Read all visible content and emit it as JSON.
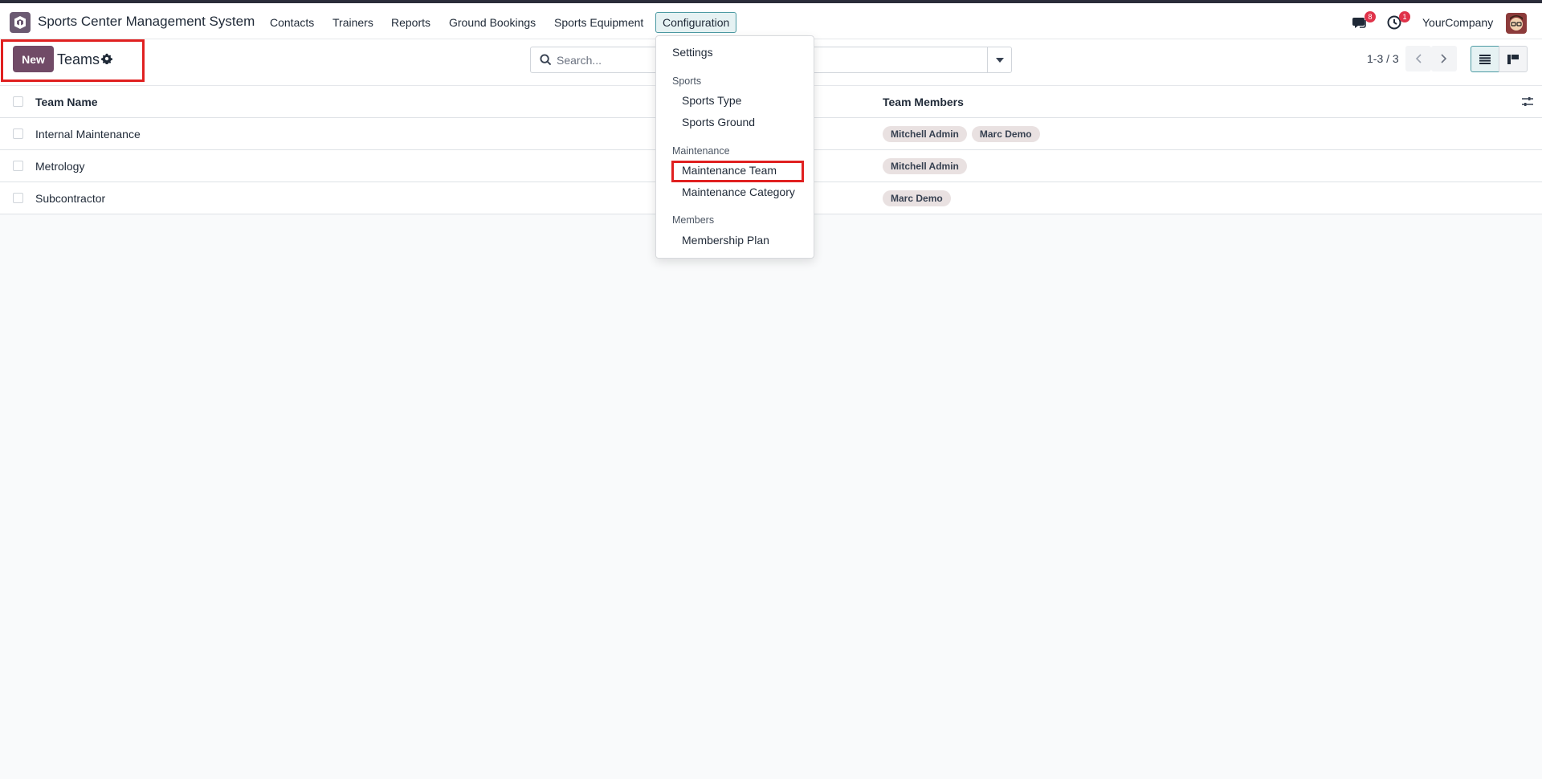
{
  "navbar": {
    "app_name": "Sports Center Management System",
    "menu": [
      "Contacts",
      "Trainers",
      "Reports",
      "Ground Bookings",
      "Sports Equipment",
      "Configuration"
    ],
    "messages_count": "8",
    "activities_count": "1",
    "company": "YourCompany"
  },
  "control": {
    "new_label": "New",
    "title": "Teams",
    "search_placeholder": "Search...",
    "pager": "1-3 / 3"
  },
  "table": {
    "headers": {
      "name": "Team Name",
      "members": "Team Members"
    },
    "rows": [
      {
        "name": "Internal Maintenance",
        "members": [
          "Mitchell Admin",
          "Marc Demo"
        ]
      },
      {
        "name": "Metrology",
        "members": [
          "Mitchell Admin"
        ]
      },
      {
        "name": "Subcontractor",
        "members": [
          "Marc Demo"
        ]
      }
    ]
  },
  "dropdown": {
    "settings": "Settings",
    "sections": [
      {
        "header": "Sports",
        "items": [
          "Sports Type",
          "Sports Ground"
        ]
      },
      {
        "header": "Maintenance",
        "items": [
          "Maintenance Team",
          "Maintenance Category"
        ]
      },
      {
        "header": "Members",
        "items": [
          "Membership Plan"
        ]
      }
    ]
  },
  "colors": {
    "brand": "#714b67",
    "accent": "#4c9aa3",
    "highlight": "#e02020",
    "badge": "#e0334a"
  }
}
